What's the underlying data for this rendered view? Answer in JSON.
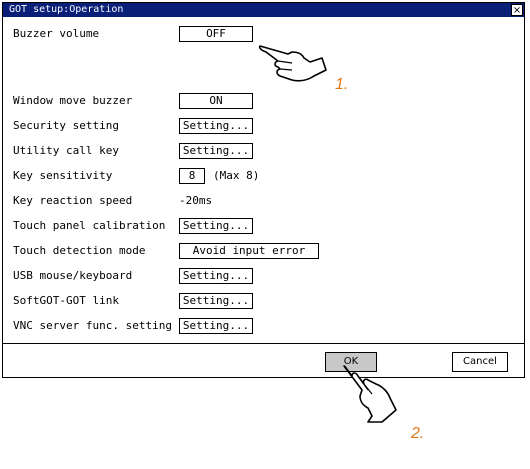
{
  "dialog": {
    "title": "GOT setup:Operation",
    "close_label": "×"
  },
  "settings": {
    "buzzer_volume": {
      "label": "Buzzer volume",
      "value": "OFF"
    },
    "window_move_buzzer": {
      "label": "Window move buzzer",
      "value": "ON"
    },
    "security_setting": {
      "label": "Security setting",
      "value": "Setting..."
    },
    "utility_call_key": {
      "label": "Utility call key",
      "value": "Setting..."
    },
    "key_sensitivity": {
      "label": "Key sensitivity",
      "value": "8",
      "note": "(Max 8)"
    },
    "key_reaction_speed": {
      "label": "Key reaction speed",
      "value": "-20ms"
    },
    "touch_panel_calibration": {
      "label": "Touch panel calibration",
      "value": "Setting..."
    },
    "touch_detection_mode": {
      "label": "Touch detection mode",
      "value": "Avoid input error"
    },
    "usb_mouse_keyboard": {
      "label": "USB mouse/keyboard",
      "value": "Setting..."
    },
    "softgot_got_link": {
      "label": "SoftGOT-GOT link",
      "value": "Setting..."
    },
    "vnc_server": {
      "label": "VNC server func. setting",
      "value": "Setting..."
    }
  },
  "buttons": {
    "ok": "OK",
    "cancel": "Cancel"
  },
  "callouts": {
    "step1": "1.",
    "step2": "2."
  },
  "colors": {
    "titlebar": "#0a1f78",
    "callout": "#e07818",
    "ok_button": "#c8c8c8"
  },
  "icons": {
    "pointer": "pointing-hand-icon"
  }
}
